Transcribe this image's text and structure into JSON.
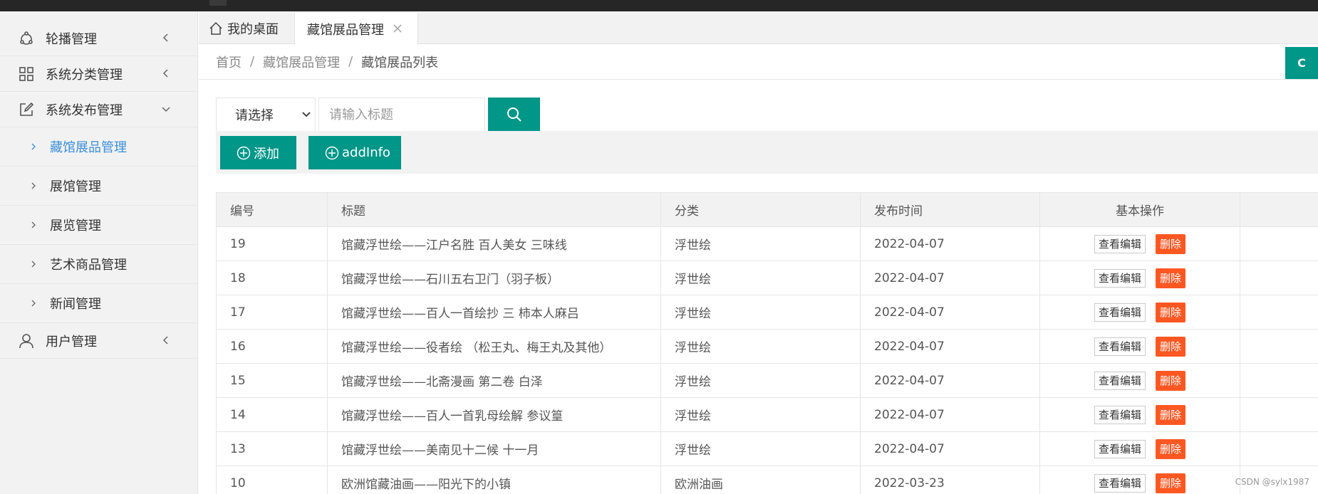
{
  "sidebar": {
    "items": [
      {
        "label": "轮播管理",
        "icon": "carousel-icon"
      },
      {
        "label": "系统分类管理",
        "icon": "grid-icon"
      },
      {
        "label": "系统发布管理",
        "icon": "edit-icon"
      },
      {
        "label": "用户管理",
        "icon": "user-icon"
      }
    ],
    "sub_items": [
      {
        "label": "藏馆展品管理"
      },
      {
        "label": "展馆管理"
      },
      {
        "label": "展览管理"
      },
      {
        "label": "艺术商品管理"
      },
      {
        "label": "新闻管理"
      }
    ]
  },
  "tabs": {
    "home": "我的桌面",
    "current": "藏馆展品管理"
  },
  "breadcrumb": [
    "首页",
    "藏馆展品管理",
    "藏馆展品列表"
  ],
  "refresh_label": "C",
  "search": {
    "select_value": "请选择",
    "placeholder": "请输入标题"
  },
  "actions": {
    "add": "添加",
    "add_info": "addInfo"
  },
  "table": {
    "headers": [
      "编号",
      "标题",
      "分类",
      "发布时间",
      "基本操作"
    ],
    "view_label": "查看编辑",
    "delete_label": "删除",
    "rows": [
      {
        "id": "19",
        "title": "馆藏浮世绘——江户名胜 百人美女 三味线",
        "category": "浮世绘",
        "date": "2022-04-07"
      },
      {
        "id": "18",
        "title": "馆藏浮世绘——石川五右卫门（羽子板）",
        "category": "浮世绘",
        "date": "2022-04-07"
      },
      {
        "id": "17",
        "title": "馆藏浮世绘——百人一首绘抄 三 柿本人麻吕",
        "category": "浮世绘",
        "date": "2022-04-07"
      },
      {
        "id": "16",
        "title": "馆藏浮世绘——役者绘 （松王丸、梅王丸及其他）",
        "category": "浮世绘",
        "date": "2022-04-07"
      },
      {
        "id": "15",
        "title": "馆藏浮世绘——北斋漫画 第二卷 白泽",
        "category": "浮世绘",
        "date": "2022-04-07"
      },
      {
        "id": "14",
        "title": "馆藏浮世绘——百人一首乳母绘解 参议篁",
        "category": "浮世绘",
        "date": "2022-04-07"
      },
      {
        "id": "13",
        "title": "馆藏浮世绘——美南见十二候 十一月",
        "category": "浮世绘",
        "date": "2022-04-07"
      },
      {
        "id": "10",
        "title": "欧洲馆藏油画——阳光下的小镇",
        "category": "欧洲油画",
        "date": "2022-03-23"
      }
    ]
  },
  "watermark": "CSDN @sylx1987",
  "colors": {
    "primary": "#009688",
    "danger": "#FF5722",
    "active_link": "#3b8fd9"
  }
}
